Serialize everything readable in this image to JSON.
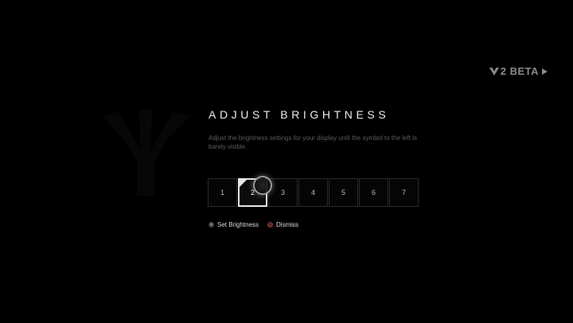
{
  "badge": {
    "text": "2 BETA"
  },
  "dialog": {
    "title": "ADJUST BRIGHTNESS",
    "description": "Adjust the brightness settings for your display until the symbol to the left is barely visible."
  },
  "brightness": {
    "levels": [
      "1",
      "2",
      "3",
      "4",
      "5",
      "6",
      "7"
    ],
    "selected": "2"
  },
  "actions": {
    "set": {
      "glyph": "A",
      "label": "Set Brightness"
    },
    "dismiss": {
      "glyph": "B",
      "label": "Dismiss"
    }
  },
  "colors": {
    "background": "#000000",
    "title": "#ececec",
    "description": "#5b5b5b",
    "selected_border": "#e6e6e6",
    "dismiss_glyph": "#7a3a3a"
  }
}
